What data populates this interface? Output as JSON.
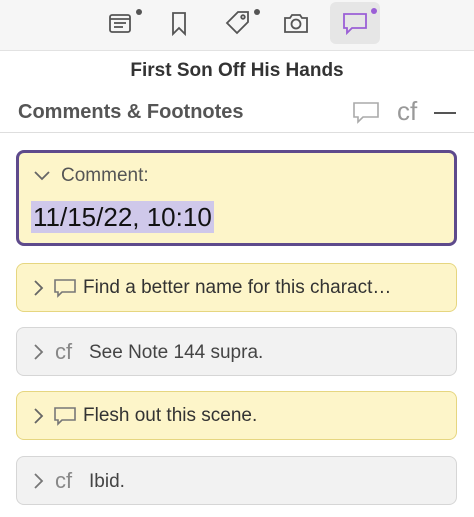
{
  "toolbar": {
    "icons": [
      "notes-icon",
      "bookmark-icon",
      "tag-icon",
      "camera-icon",
      "comment-icon"
    ],
    "active": "comment-icon",
    "accent_color": "#9b5fd6"
  },
  "document_title": "First Son Off His Hands",
  "section": {
    "title": "Comments & Footnotes",
    "footnote_symbol": "cf"
  },
  "expanded_comment": {
    "label": "Comment:",
    "value": "11/15/22, 10:10"
  },
  "items": [
    {
      "kind": "comment",
      "text": "Find a better name for this charact…"
    },
    {
      "kind": "footnote",
      "symbol": "cf",
      "text": "See Note 144 supra."
    },
    {
      "kind": "comment",
      "text": "Flesh out this scene."
    },
    {
      "kind": "footnote",
      "symbol": "cf",
      "text": "Ibid."
    }
  ],
  "colors": {
    "comment_bg": "#fdf5c9",
    "footnote_bg": "#f2f2f2",
    "selected_border": "#5e4a8c",
    "selection_highlight": "#cfc8ea"
  }
}
